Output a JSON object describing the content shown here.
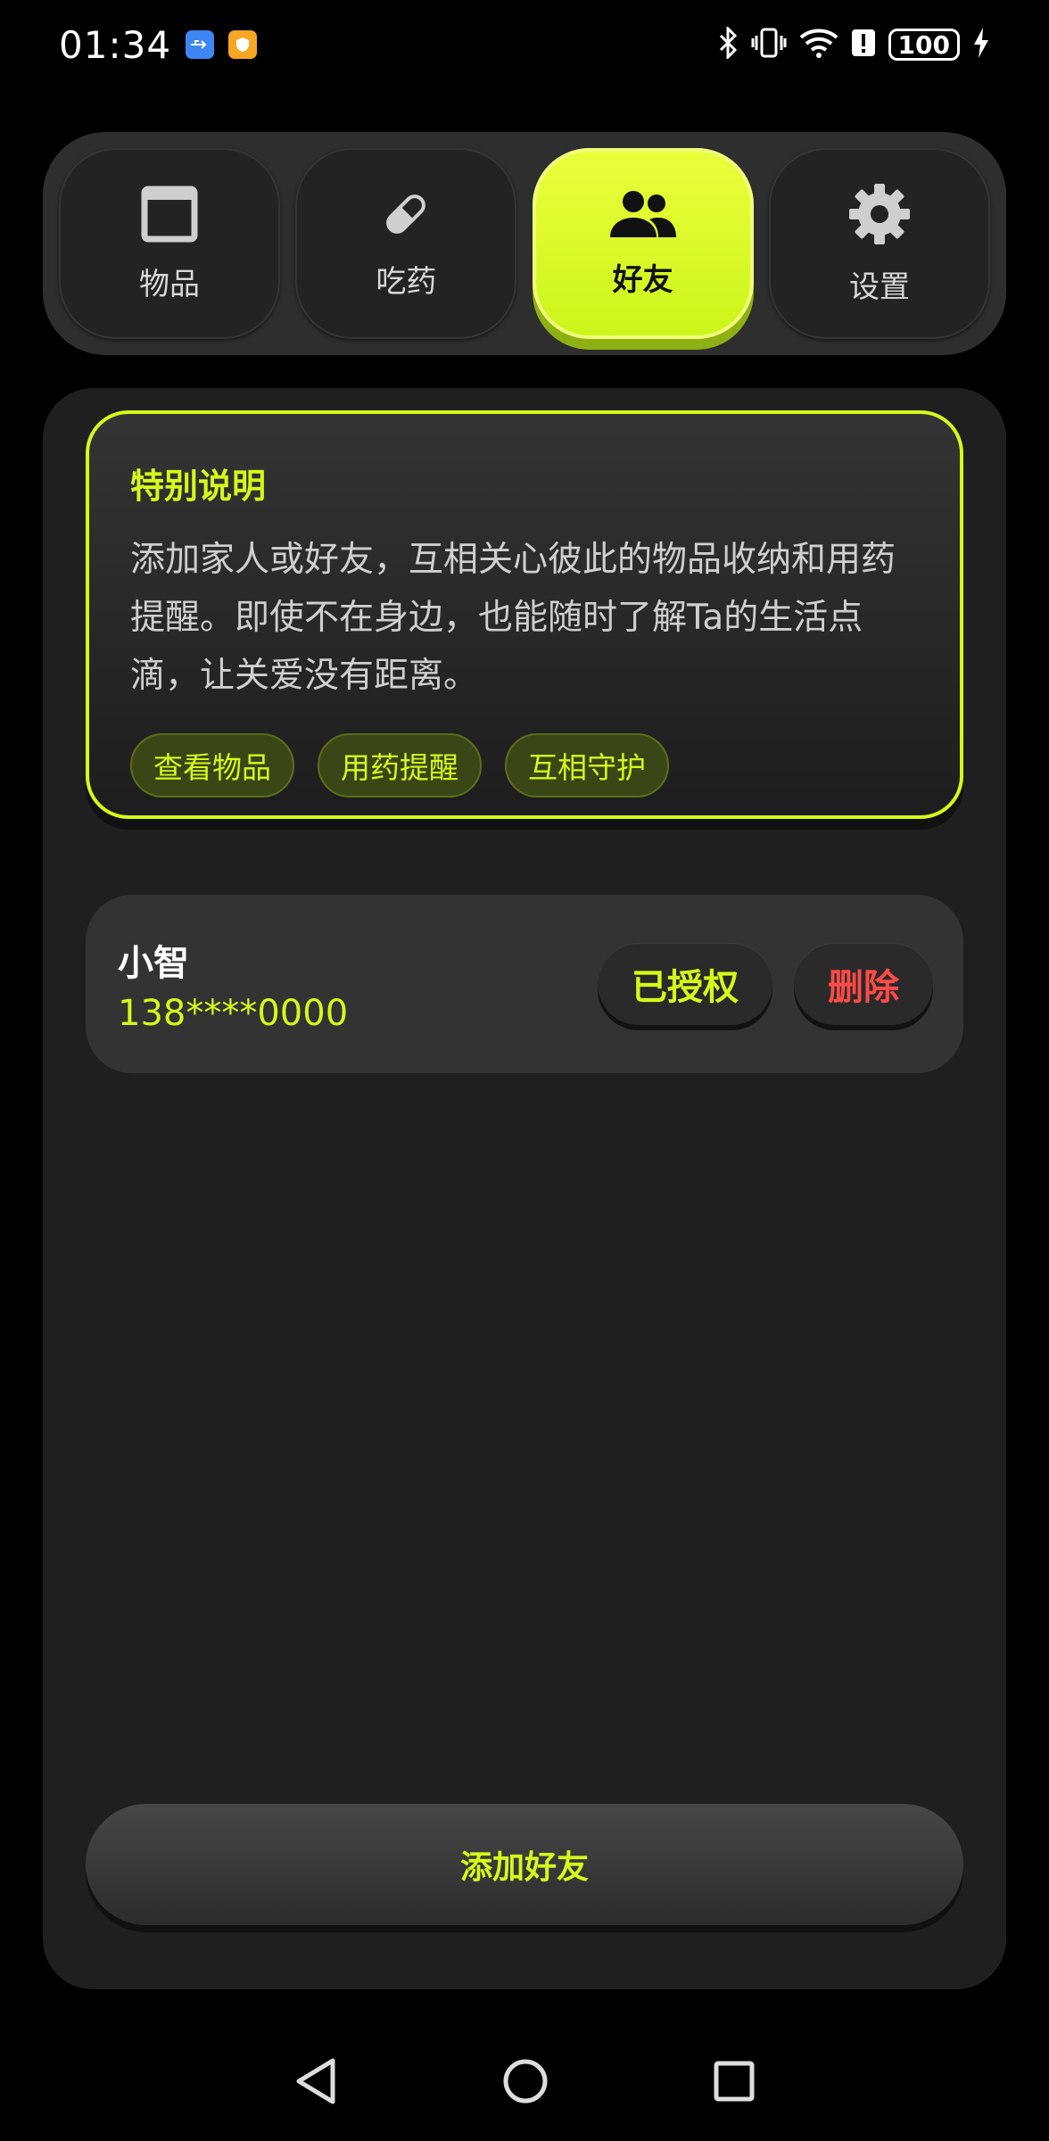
{
  "status_bar": {
    "time": "01:34",
    "battery": "100",
    "app_icons": [
      "usb-icon",
      "shield-app-icon"
    ],
    "system_icons": [
      "bluetooth-icon",
      "vibrate-icon",
      "wifi-icon",
      "alert-icon",
      "battery-icon",
      "charging-icon"
    ]
  },
  "tabs": [
    {
      "label": "物品",
      "icon": "box-icon",
      "active": false
    },
    {
      "label": "吃药",
      "icon": "pill-icon",
      "active": false
    },
    {
      "label": "好友",
      "icon": "people-icon",
      "active": true
    },
    {
      "label": "设置",
      "icon": "gear-icon",
      "active": false
    }
  ],
  "note": {
    "title": "特别说明",
    "body": "添加家人或好友，互相关心彼此的物品收纳和用药提醒。即使不在身边，也能随时了解Ta的生活点滴，让关爱没有距离。",
    "chips": [
      "查看物品",
      "用药提醒",
      "互相守护"
    ]
  },
  "friends": [
    {
      "name": "小智",
      "phone": "138****0000",
      "auth_label": "已授权",
      "delete_label": "删除"
    }
  ],
  "add_button_label": "添加好友",
  "colors": {
    "accent": "#d4fa19",
    "danger": "#ff4b47",
    "panel": "#1f1f1f",
    "background": "#000000"
  }
}
